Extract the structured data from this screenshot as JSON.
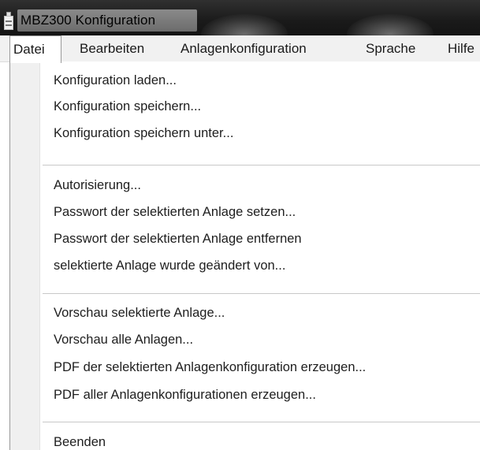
{
  "window": {
    "title": "MBZ300 Konfiguration",
    "app_icon": "app-icon"
  },
  "menubar": {
    "items": [
      {
        "label": "Datei",
        "active": true
      },
      {
        "label": "Bearbeiten",
        "active": false
      },
      {
        "label": "Anlagenkonfiguration",
        "active": false
      },
      {
        "label": "Sprache",
        "active": false
      },
      {
        "label": "Hilfe",
        "active": false
      }
    ]
  },
  "dropdown": {
    "groups": [
      [
        "Konfiguration laden...",
        "Konfiguration speichern...",
        "Konfiguration speichern unter..."
      ],
      [
        "Autorisierung...",
        "Passwort der selektierten Anlage setzen...",
        "Passwort der selektierten Anlage entfernen",
        "selektierte Anlage wurde geändert von..."
      ],
      [
        "Vorschau selektierte Anlage...",
        "Vorschau alle Anlagen...",
        "PDF der selektierten Anlagenkonfiguration erzeugen...",
        "PDF aller Anlagenkonfigurationen erzeugen..."
      ],
      [
        "Beenden"
      ]
    ]
  }
}
